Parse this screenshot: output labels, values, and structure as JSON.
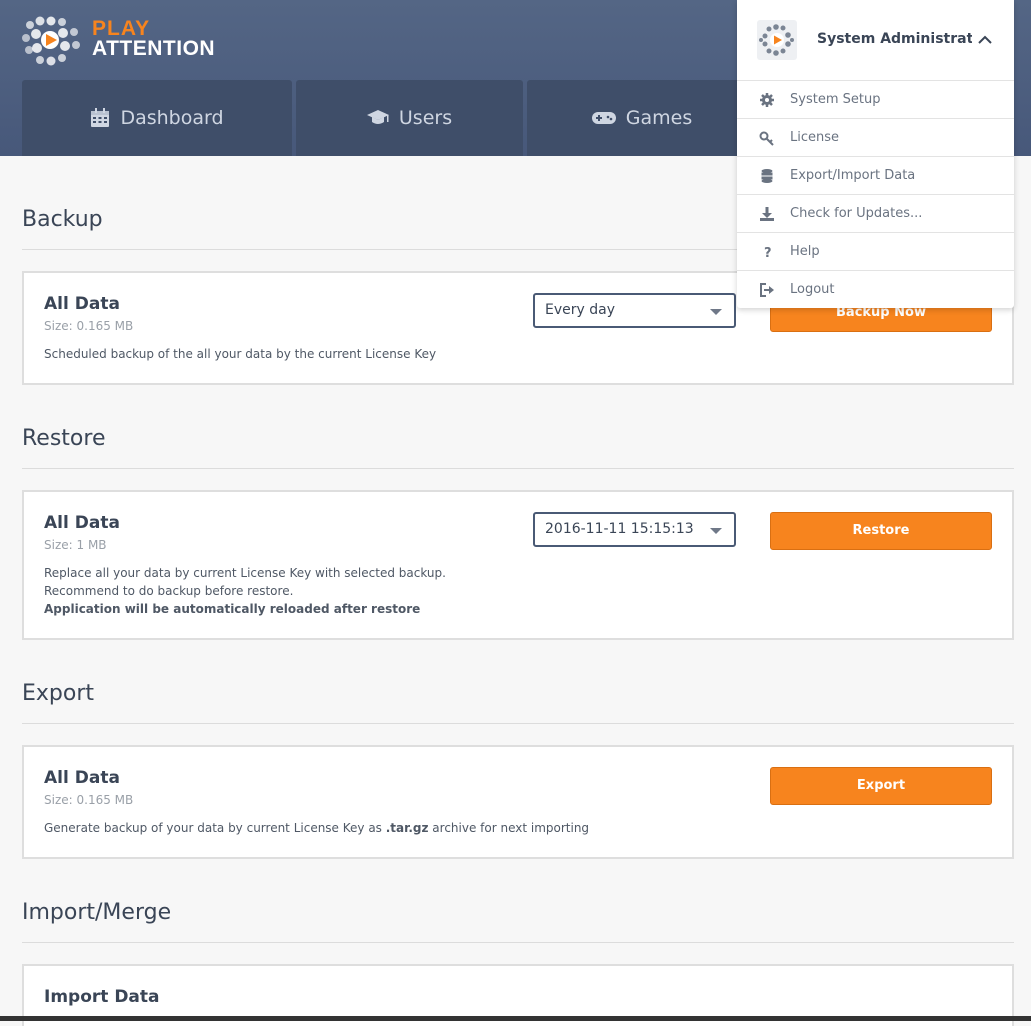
{
  "app": {
    "logo_play": "PLAY",
    "logo_attention": "ATTENTION"
  },
  "nav": {
    "tabs": [
      {
        "label": "Dashboard",
        "icon": "calendar-icon"
      },
      {
        "label": "Users",
        "icon": "graduation-cap-icon"
      },
      {
        "label": "Games",
        "icon": "gamepad-icon"
      }
    ]
  },
  "user_menu": {
    "username": "System Administrat...",
    "items": [
      {
        "label": "System Setup",
        "icon": "gear-icon"
      },
      {
        "label": "License",
        "icon": "key-icon"
      },
      {
        "label": "Export/Import Data",
        "icon": "database-icon"
      },
      {
        "label": "Check for Updates...",
        "icon": "download-icon"
      },
      {
        "label": "Help",
        "icon": "question-icon"
      },
      {
        "label": "Logout",
        "icon": "logout-icon"
      }
    ]
  },
  "backup": {
    "title": "Backup",
    "card_title": "All Data",
    "size": "Size: 0.165 MB",
    "description": "Scheduled backup of the all your data by the current License Key",
    "schedule_value": "Every day",
    "button_label": "Backup Now"
  },
  "restore": {
    "title": "Restore",
    "card_title": "All Data",
    "size": "Size: 1 MB",
    "desc_line1": "Replace all your data by current License Key with selected backup.",
    "desc_line2": "Recommend to do backup before restore.",
    "desc_line3": "Application will be automatically reloaded after restore",
    "backup_value": "2016-11-11 15:15:13",
    "button_label": "Restore"
  },
  "export": {
    "title": "Export",
    "card_title": "All Data",
    "size": "Size: 0.165 MB",
    "desc_prefix": "Generate backup of your data by current License Key as ",
    "desc_ext": ".tar.gz",
    "desc_suffix": " archive for next importing",
    "button_label": "Export"
  },
  "import": {
    "title": "Import/Merge",
    "card_title": "Import Data"
  },
  "colors": {
    "header": "#4f6081",
    "accent": "#f7841e",
    "tab": "#3f4e69"
  }
}
